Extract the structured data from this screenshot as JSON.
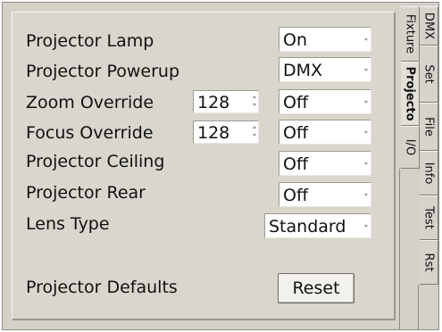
{
  "rows": [
    {
      "label": "Projector Lamp",
      "value": "On"
    },
    {
      "label": "Projector Powerup",
      "value": "DMX"
    },
    {
      "label": "Zoom Override",
      "spin": "128",
      "value": "Off"
    },
    {
      "label": "Focus Override",
      "spin": "128",
      "value": "Off"
    },
    {
      "label": "Projector Ceiling",
      "value": "Off"
    },
    {
      "label": "Projector Rear",
      "value": "Off"
    },
    {
      "label": "Lens Type",
      "value": "Standard"
    }
  ],
  "defaults": {
    "label": "Projector Defaults",
    "button": "Reset"
  },
  "tabs": {
    "dmx": "DMX",
    "set": "Set",
    "file": "File",
    "info": "Info",
    "test": "Test",
    "rst": "Rst",
    "fixture": "Fixture",
    "projector": "Projecto",
    "io": "I/O"
  }
}
